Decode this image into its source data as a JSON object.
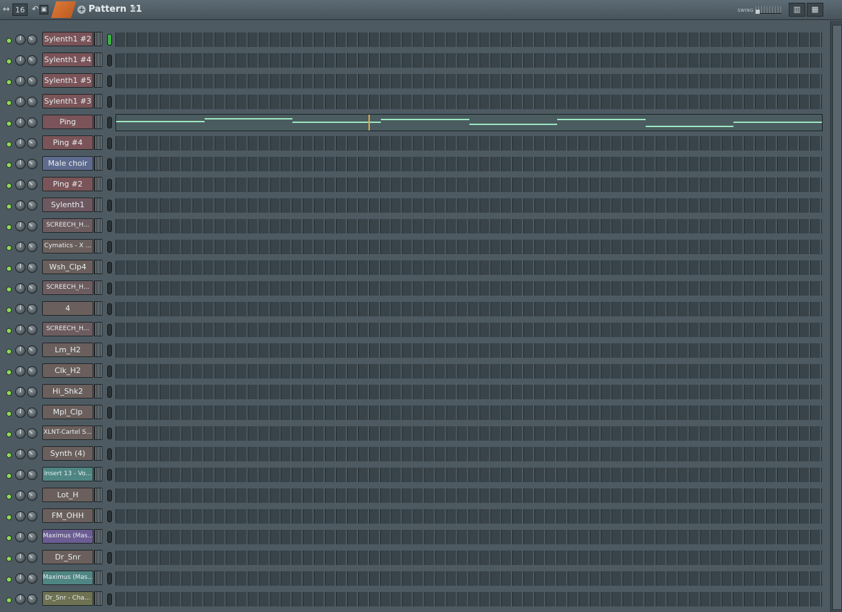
{
  "titlebar": {
    "steps": "16",
    "pattern_name": "Pattern 11",
    "swing_label": "SWING"
  },
  "channels": [
    {
      "name": "Sylenth1 #2",
      "color": "#7a5458",
      "selected": true
    },
    {
      "name": "Sylenth1 #4",
      "color": "#7a5458",
      "selected": false
    },
    {
      "name": "Sylenth1 #5",
      "color": "#7a5458",
      "selected": false
    },
    {
      "name": "Sylenth1 #3",
      "color": "#7a5458",
      "selected": false
    },
    {
      "name": "Ping",
      "color": "#7a5458",
      "selected": false,
      "piano_roll": true
    },
    {
      "name": "Ping #4",
      "color": "#7a5458",
      "selected": false
    },
    {
      "name": "Male choir",
      "color": "#5f6b8e",
      "selected": false
    },
    {
      "name": "Ping #2",
      "color": "#7a5458",
      "selected": false
    },
    {
      "name": "Sylenth1",
      "color": "#6e5860",
      "selected": false
    },
    {
      "name": "SCREECH_H...",
      "color": "#6d5c5f",
      "selected": false
    },
    {
      "name": "Cymatics - X ...",
      "color": "#6a5f5c",
      "selected": false
    },
    {
      "name": "Wsh_Clp4",
      "color": "#6a5f5c",
      "selected": false
    },
    {
      "name": "SCREECH_H...",
      "color": "#6d5c5f",
      "selected": false
    },
    {
      "name": "4",
      "color": "#6a5f5c",
      "selected": false
    },
    {
      "name": "SCREECH_H...",
      "color": "#6d5c5f",
      "selected": false
    },
    {
      "name": "Lm_H2",
      "color": "#6a5f5c",
      "selected": false
    },
    {
      "name": "Clk_H2",
      "color": "#6a5f5c",
      "selected": false
    },
    {
      "name": "Hi_Shk2",
      "color": "#6a5f5c",
      "selected": false
    },
    {
      "name": "Mpl_Clp",
      "color": "#6a5f5c",
      "selected": false
    },
    {
      "name": "XLNT-Cartel S...",
      "color": "#6a5f5c",
      "selected": false
    },
    {
      "name": "Synth (4)",
      "color": "#6a5f5c",
      "selected": false
    },
    {
      "name": "Insert 13 - Vo...",
      "color": "#4f8683",
      "selected": false
    },
    {
      "name": "Lot_H",
      "color": "#6a5f5c",
      "selected": false
    },
    {
      "name": "FM_OHH",
      "color": "#6a5f5c",
      "selected": false
    },
    {
      "name": "Maximus (Mas...",
      "color": "#6b5d93",
      "selected": false
    },
    {
      "name": "Dr_Snr",
      "color": "#6a5f5c",
      "selected": false
    },
    {
      "name": "Maximus (Mas...",
      "color": "#4f8683",
      "selected": false
    },
    {
      "name": "Dr_Snr - Cha...",
      "color": "#6e7252",
      "selected": false
    }
  ],
  "piano_notes": [
    {
      "start": 0,
      "end": 0.125,
      "level": 0.35
    },
    {
      "start": 0.125,
      "end": 0.25,
      "level": 0.1
    },
    {
      "start": 0.25,
      "end": 0.375,
      "level": 0.45
    },
    {
      "start": 0.375,
      "end": 0.5,
      "level": 0.2
    },
    {
      "start": 0.5,
      "end": 0.625,
      "level": 0.6
    },
    {
      "start": 0.625,
      "end": 0.75,
      "level": 0.2
    },
    {
      "start": 0.75,
      "end": 0.875,
      "level": 0.8
    },
    {
      "start": 0.875,
      "end": 1.0,
      "level": 0.45
    }
  ]
}
